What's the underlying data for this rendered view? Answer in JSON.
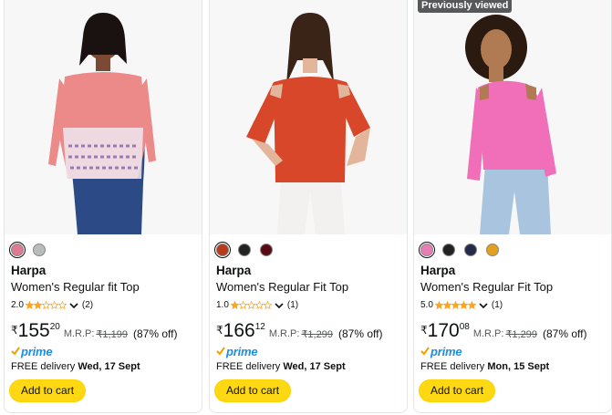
{
  "colors": {
    "prime_blue": "#1b8ee5",
    "star_orange": "#ffa41c",
    "cart_yellow": "#ffd814"
  },
  "products": [
    {
      "badge": "",
      "swatches": [
        "#e07a92",
        "#b9bcbd"
      ],
      "brand": "Harpa",
      "title": "Women's Regular fit Top",
      "rating": "2.0",
      "stars": 2,
      "review_count": "(2)",
      "currency": "₹",
      "price_whole": "155",
      "price_fraction": "20",
      "mrp_label": "M.R.P:",
      "mrp_value": "₹1,199",
      "discount": "(87% off)",
      "prime_label": "prime",
      "delivery_prefix": "FREE delivery",
      "delivery_date": "Wed, 17 Sept",
      "cart_label": "Add to cart",
      "top_color": "#ec8a8a"
    },
    {
      "badge": "",
      "swatches": [
        "#b83a1a",
        "#222222",
        "#5a0a12"
      ],
      "brand": "Harpa",
      "title": "Women's Regular Fit Top",
      "rating": "1.0",
      "stars": 1,
      "review_count": "(1)",
      "currency": "₹",
      "price_whole": "166",
      "price_fraction": "12",
      "mrp_label": "M.R.P:",
      "mrp_value": "₹1,299",
      "discount": "(87% off)",
      "prime_label": "prime",
      "delivery_prefix": "FREE delivery",
      "delivery_date": "Wed, 17 Sept",
      "cart_label": "Add to cart",
      "top_color": "#d9472a"
    },
    {
      "badge": "Previously viewed",
      "swatches": [
        "#ea7bb4",
        "#222222",
        "#232a4a",
        "#e3a01a"
      ],
      "brand": "Harpa",
      "title": "Women's Regular Fit Top",
      "rating": "5.0",
      "stars": 5,
      "review_count": "(1)",
      "currency": "₹",
      "price_whole": "170",
      "price_fraction": "08",
      "mrp_label": "M.R.P:",
      "mrp_value": "₹1,299",
      "discount": "(87% off)",
      "prime_label": "prime",
      "delivery_prefix": "FREE delivery",
      "delivery_date": "Mon, 15 Sept",
      "cart_label": "Add to cart",
      "top_color": "#f06fb8"
    }
  ]
}
